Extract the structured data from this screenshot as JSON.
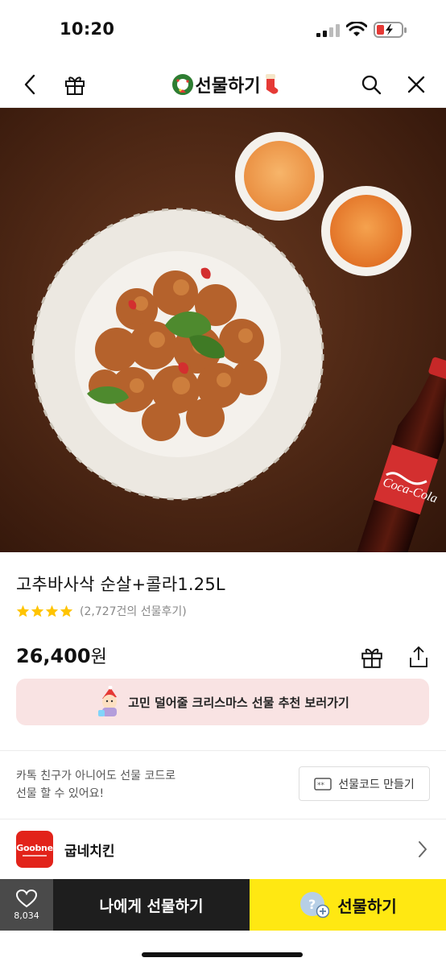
{
  "status_bar": {
    "time": "10:20"
  },
  "nav": {
    "title": "선물하기",
    "icons": [
      "back-chevron",
      "gift-box",
      "wreath",
      "christmas-stocking",
      "search",
      "close"
    ]
  },
  "hero": {
    "image_description_icons": [
      "fried-chicken-plate",
      "sauce-bowl",
      "sauce-bowl",
      "cola-bottle"
    ],
    "bottle_brand": "Coca-Cola"
  },
  "product": {
    "title": "고추바사삭 순살+콜라1.25L",
    "rating_stars": 4,
    "review_text": "(2,727건의 선물후기)",
    "price": "26,400",
    "price_unit": "원"
  },
  "promo": {
    "text": "고민 덜어줄 크리스마스 선물 추천 보러가기",
    "background": "#f9e3e3"
  },
  "gift_code": {
    "description_line1": "카톡 친구가 아니어도 선물 코드로",
    "description_line2": "선물 할 수 있어요!",
    "button_label": "선물코드 만들기"
  },
  "brand": {
    "logo_text": "Goobne",
    "name": "굽네치킨",
    "logo_color": "#e2231a"
  },
  "bottom_bar": {
    "like_count": "8,034",
    "self_gift_label": "나에게 선물하기",
    "gift_label": "선물하기",
    "gift_button_color": "#ffe812",
    "self_gift_button_color": "#1e1e1e"
  },
  "colors": {
    "star": "#ffc400",
    "accent_yellow": "#ffe812"
  }
}
